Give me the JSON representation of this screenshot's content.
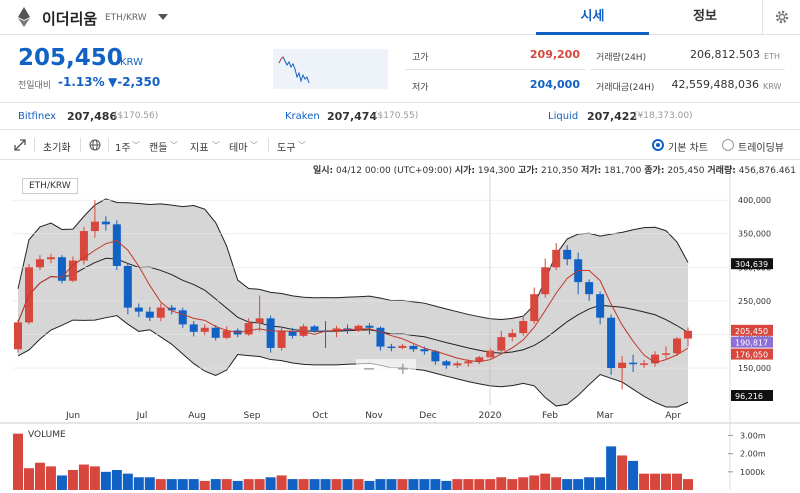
{
  "header": {
    "coin_name": "이더리움",
    "pair": "ETH/KRW",
    "tabs": [
      "시세",
      "정보"
    ],
    "icons": {
      "coin": "ethereum-icon",
      "caret": "chevron-down-icon",
      "settings": "gear-icon"
    }
  },
  "price": {
    "current": "205,450",
    "unit": "KRW",
    "change_label": "전일대비",
    "change_pct": "-1.13%",
    "change_abs": "▼-2,350",
    "high_label": "고가",
    "high": "209,200",
    "low_label": "저가",
    "low": "204,000",
    "volume_label": "거래량(24H)",
    "volume": "206,812.503",
    "volume_unit": "ETH",
    "amount_label": "거래대금(24H)",
    "amount": "42,559,488,036",
    "amount_unit": "KRW"
  },
  "exchanges": [
    {
      "name": "Bitfinex",
      "price": "207,486",
      "usd": "($170.56)"
    },
    {
      "name": "Kraken",
      "price": "207,474",
      "usd": "($170.55)"
    },
    {
      "name": "Liquid",
      "price": "207,422",
      "usd": "(¥18,373.00)"
    }
  ],
  "toolbar": {
    "reset": "초기화",
    "period": "1주",
    "type": "캔들",
    "indicator": "지표",
    "theme": "테마",
    "tools": "도구",
    "basic_chart": "기본 차트",
    "trading_view": "트레이딩뷰"
  },
  "chart_info": {
    "date_label": "일시:",
    "date": "04/12 00:00 (UTC+09:00)",
    "open_label": "시가:",
    "open": "194,300",
    "high_label": "고가:",
    "high": "210,350",
    "low_label": "저가:",
    "low": "181,700",
    "close_label": "종가:",
    "close": "205,450",
    "vol_label": "거래량:",
    "vol": "456,876.461",
    "pair_badge": "ETH/KRW",
    "volume_title": "VOLUME"
  },
  "colors": {
    "up": "#d7473d",
    "down": "#1261c4",
    "band_fill": "#d6d6d6",
    "accent": "#1261c4"
  },
  "chart_data": {
    "type": "candlestick",
    "y_ticks": [
      "400,000",
      "350,000",
      "300,000",
      "250,000",
      "200,000",
      "150,000"
    ],
    "x_ticks": [
      "Jun",
      "Jul",
      "Aug",
      "Sep",
      "Oct",
      "Nov",
      "Dec",
      "2020",
      "Feb",
      "Mar",
      "Apr"
    ],
    "price_tags": [
      "304,639",
      "205,450",
      "190,817",
      "176,050",
      "96,216"
    ],
    "vol_ticks": [
      "3.00m",
      "2.00m",
      "1000k"
    ],
    "ylim": [
      95000,
      430000
    ],
    "candles": [
      [
        178000,
        218000,
        173000,
        222000
      ],
      [
        218000,
        300000,
        215000,
        305000
      ],
      [
        300000,
        312000,
        296000,
        318000
      ],
      [
        312000,
        315000,
        306000,
        320000
      ],
      [
        315000,
        280000,
        276000,
        318000
      ],
      [
        280000,
        310000,
        278000,
        316000
      ],
      [
        310000,
        354000,
        304000,
        360000
      ],
      [
        354000,
        368000,
        344000,
        400000
      ],
      [
        368000,
        364000,
        355000,
        376000
      ],
      [
        364000,
        302000,
        296000,
        370000
      ],
      [
        302000,
        240000,
        230000,
        306000
      ],
      [
        240000,
        234000,
        226000,
        246000
      ],
      [
        234000,
        225000,
        220000,
        241000
      ],
      [
        225000,
        240000,
        220000,
        246000
      ],
      [
        240000,
        236000,
        230000,
        244000
      ],
      [
        236000,
        215000,
        210000,
        240000
      ],
      [
        215000,
        204000,
        197000,
        220000
      ],
      [
        204000,
        210000,
        199000,
        215000
      ],
      [
        210000,
        195000,
        191000,
        214000
      ],
      [
        195000,
        206000,
        193000,
        212000
      ],
      [
        206000,
        200000,
        196000,
        209000
      ],
      [
        200000,
        217000,
        198000,
        224000
      ],
      [
        217000,
        224000,
        205000,
        258000
      ],
      [
        224000,
        180000,
        173000,
        228000
      ],
      [
        180000,
        205000,
        176000,
        212000
      ],
      [
        205000,
        198000,
        194000,
        210000
      ],
      [
        198000,
        212000,
        196000,
        216000
      ],
      [
        212000,
        206000,
        203000,
        214000
      ],
      [
        206000,
        205000,
        180000,
        220000
      ],
      [
        205000,
        209000,
        196000,
        213000
      ],
      [
        209000,
        206000,
        201000,
        215000
      ],
      [
        206000,
        213000,
        204000,
        215000
      ],
      [
        213000,
        210000,
        200000,
        217000
      ],
      [
        210000,
        182000,
        176000,
        212000
      ],
      [
        182000,
        180000,
        175000,
        186000
      ],
      [
        180000,
        183000,
        178000,
        186000
      ],
      [
        183000,
        178000,
        174000,
        185000
      ],
      [
        178000,
        175000,
        170000,
        182000
      ],
      [
        175000,
        160000,
        155000,
        177000
      ],
      [
        160000,
        154000,
        149000,
        162000
      ],
      [
        154000,
        157000,
        150000,
        160000
      ],
      [
        157000,
        160000,
        152000,
        163000
      ],
      [
        160000,
        166000,
        156000,
        168000
      ],
      [
        166000,
        176000,
        163000,
        180000
      ],
      [
        176000,
        196000,
        174000,
        205000
      ],
      [
        196000,
        202000,
        190000,
        208000
      ],
      [
        202000,
        220000,
        198000,
        228000
      ],
      [
        220000,
        260000,
        216000,
        270000
      ],
      [
        260000,
        300000,
        255000,
        313000
      ],
      [
        300000,
        326000,
        296000,
        336000
      ],
      [
        326000,
        312000,
        303000,
        333000
      ],
      [
        312000,
        278000,
        260000,
        322000
      ],
      [
        278000,
        260000,
        250000,
        282000
      ],
      [
        260000,
        225000,
        215000,
        264000
      ],
      [
        225000,
        150000,
        140000,
        230000
      ],
      [
        150000,
        158000,
        118000,
        168000
      ],
      [
        158000,
        156000,
        144000,
        170000
      ],
      [
        156000,
        157000,
        150000,
        162000
      ],
      [
        157000,
        170000,
        152000,
        175000
      ],
      [
        170000,
        172000,
        164000,
        182000
      ],
      [
        172000,
        194000,
        168000,
        196000
      ],
      [
        194000,
        205450,
        181700,
        210350
      ]
    ],
    "volumes": [
      3.1,
      1.2,
      1.5,
      1.3,
      0.8,
      1.1,
      1.4,
      1.3,
      1.0,
      1.1,
      0.9,
      0.7,
      0.7,
      0.6,
      0.6,
      0.6,
      0.6,
      0.5,
      0.6,
      0.6,
      0.5,
      0.6,
      0.6,
      0.7,
      0.8,
      0.6,
      0.6,
      0.6,
      0.6,
      0.6,
      0.6,
      0.6,
      0.5,
      0.6,
      0.6,
      0.6,
      0.6,
      0.6,
      0.6,
      0.5,
      0.6,
      0.6,
      0.6,
      0.6,
      0.7,
      0.6,
      0.7,
      0.8,
      0.9,
      0.7,
      0.6,
      0.6,
      0.7,
      0.7,
      2.4,
      1.9,
      1.6,
      0.9,
      0.9,
      0.9,
      0.9,
      0.6
    ]
  }
}
